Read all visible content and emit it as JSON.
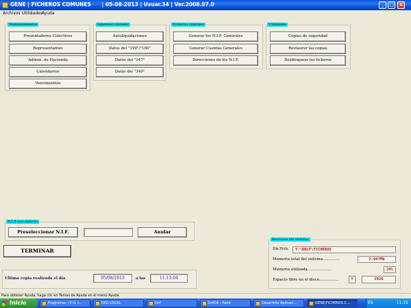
{
  "window": {
    "title": "GENE | FICHEROS COMUNES      | 05-08-2013 | Usuar.34 | Ver.2008.07.0"
  },
  "menu": [
    "Archivos",
    "Utilidades",
    "Ayuda"
  ],
  "groups": {
    "mantenimientos": {
      "label": "Mantenimientos",
      "buttons": [
        "Presentadores Colectivos",
        "Representantes",
        "Admon. de Hacienda",
        "Calendarios",
        "Vencimientos"
      ]
    },
    "impresos": {
      "label": "Impresos oficiales",
      "buttons": [
        "Autoliquidaciones",
        "Datos del \"190\"/\"180\"",
        "Datos del \"347\"",
        "Datos del \"349\""
      ]
    },
    "ficheros": {
      "label": "Ficheros comunes",
      "buttons": [
        "Generar los N.I.F. Generales",
        "Generar Cuentas Generales",
        "Direcciones de los N.I.F."
      ]
    },
    "utilidades": {
      "label": "Utilidades",
      "buttons": [
        "Copias de seguridad",
        "Restaurar las copias",
        "Desbloquear los ficheros"
      ]
    },
    "nif": {
      "label": "N.I.F. por defecto",
      "preselect_label": "Preseleccionar N.I.F.",
      "nif_value": "",
      "anular_label": "Anular"
    }
  },
  "terminar_label": "TERMINAR",
  "backup": {
    "label": "Ultima copia realizada el día",
    "date": "05/08/2013",
    "at_label": "a las",
    "time": "11:13:04"
  },
  "recursos": {
    "label": "Recursos del sistema",
    "dir_label": "Dir.Fich.",
    "dir_value": "Y:\\DRLF\\FICHEROS",
    "mem_total_label": "Memoria total del sistema..............",
    "mem_total_value": "2.047Mb",
    "mem_used_label": "Memoria utilizada....................",
    "mem_used_value": "24%",
    "disk_label": "Espacio libre en el disco................",
    "disk_drive": "Y",
    "disk_value": "292G"
  },
  "status_text": "Para obtener Ayuda, haga clic en Temas de Ayuda en el menú Ayuda.",
  "taskbar": {
    "start": "Inicio",
    "tasks": [
      "Programas | E.O. I...",
      "RED LOCAL",
      "Drlf",
      "Drlf06 - Paint",
      "Desarrollo Aplicaci...",
      "GENE|FICHEROS C..."
    ],
    "lang": "ES",
    "clock": "11:15"
  },
  "colors": {
    "group_label_bg": "#00E5F5",
    "titlebar": "#0A56E4",
    "taskbar": "#245EDB"
  }
}
